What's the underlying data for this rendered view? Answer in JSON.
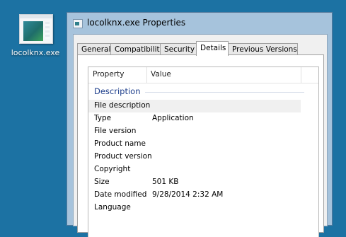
{
  "desktop": {
    "icon_label": "locolknx.exe"
  },
  "window": {
    "title": "locolknx.exe Properties",
    "tabs": [
      {
        "label": "General"
      },
      {
        "label": "Compatibility"
      },
      {
        "label": "Security"
      },
      {
        "label": "Details",
        "active": true
      },
      {
        "label": "Previous Versions"
      }
    ]
  },
  "details": {
    "columns": {
      "property": "Property",
      "value": "Value"
    },
    "group_label": "Description",
    "rows": [
      {
        "property": "File description",
        "value": ""
      },
      {
        "property": "Type",
        "value": "Application"
      },
      {
        "property": "File version",
        "value": ""
      },
      {
        "property": "Product name",
        "value": ""
      },
      {
        "property": "Product version",
        "value": ""
      },
      {
        "property": "Copyright",
        "value": ""
      },
      {
        "property": "Size",
        "value": "501 KB"
      },
      {
        "property": "Date modified",
        "value": "9/28/2014 2:32 AM"
      },
      {
        "property": "Language",
        "value": ""
      }
    ]
  }
}
